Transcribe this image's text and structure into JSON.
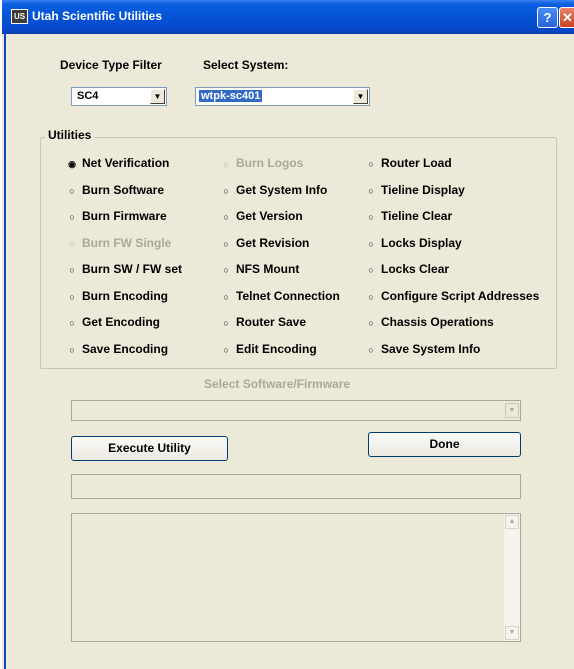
{
  "window": {
    "title": "Utah Scientific Utilities",
    "icon_text": "US",
    "help": "?",
    "close": "✕"
  },
  "device_filter": {
    "label": "Device Type Filter",
    "value": "SC4"
  },
  "system": {
    "label": "Select System:",
    "value": "wtpk-sc401"
  },
  "utilities": {
    "label": "Utilities",
    "col1": [
      {
        "label": "Net Verification",
        "selected": true,
        "disabled": false
      },
      {
        "label": "Burn Software",
        "selected": false,
        "disabled": false
      },
      {
        "label": "Burn Firmware",
        "selected": false,
        "disabled": false
      },
      {
        "label": "Burn FW Single",
        "selected": false,
        "disabled": true
      },
      {
        "label": "Burn SW / FW set",
        "selected": false,
        "disabled": false
      },
      {
        "label": "Burn Encoding",
        "selected": false,
        "disabled": false
      },
      {
        "label": "Get Encoding",
        "selected": false,
        "disabled": false
      },
      {
        "label": "Save Encoding",
        "selected": false,
        "disabled": false
      }
    ],
    "col2": [
      {
        "label": "Burn Logos",
        "selected": false,
        "disabled": true
      },
      {
        "label": "Get System Info",
        "selected": false,
        "disabled": false
      },
      {
        "label": "Get Version",
        "selected": false,
        "disabled": false
      },
      {
        "label": "Get Revision",
        "selected": false,
        "disabled": false
      },
      {
        "label": "NFS Mount",
        "selected": false,
        "disabled": false
      },
      {
        "label": "Telnet Connection",
        "selected": false,
        "disabled": false
      },
      {
        "label": "Router Save",
        "selected": false,
        "disabled": false
      },
      {
        "label": "Edit Encoding",
        "selected": false,
        "disabled": false
      }
    ],
    "col3": [
      {
        "label": "Router Load",
        "selected": false,
        "disabled": false
      },
      {
        "label": "Tieline Display",
        "selected": false,
        "disabled": false
      },
      {
        "label": "Tieline Clear",
        "selected": false,
        "disabled": false
      },
      {
        "label": "Locks Display",
        "selected": false,
        "disabled": false
      },
      {
        "label": "Locks Clear",
        "selected": false,
        "disabled": false
      },
      {
        "label": "Configure Script Addresses",
        "selected": false,
        "disabled": false
      },
      {
        "label": "Chassis Operations",
        "selected": false,
        "disabled": false
      },
      {
        "label": "Save System Info",
        "selected": false,
        "disabled": false
      }
    ]
  },
  "software": {
    "label": "Select Software/Firmware",
    "value": ""
  },
  "buttons": {
    "execute": "Execute Utility",
    "done": "Done"
  },
  "status_field": {
    "value": ""
  },
  "output": {
    "value": ""
  }
}
